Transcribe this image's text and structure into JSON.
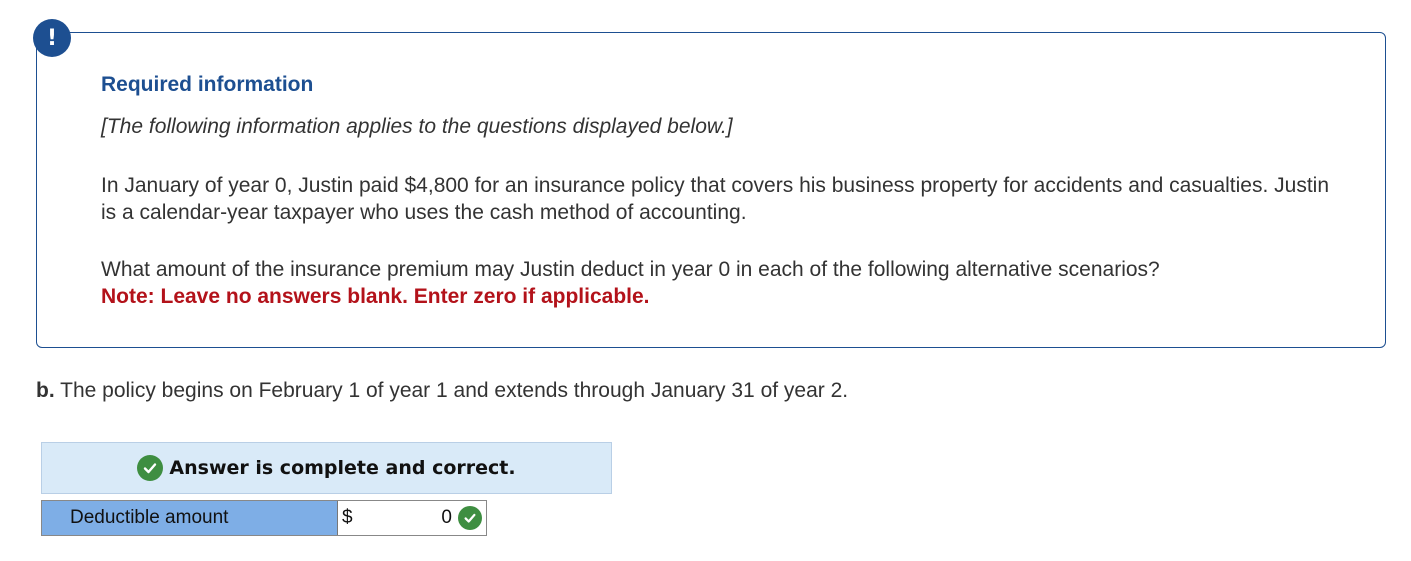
{
  "alert_icon_glyph": "!",
  "info": {
    "title": "Required information",
    "intro": "[The following information applies to the questions displayed below.]",
    "paragraph": "In January of year 0, Justin paid $4,800 for an insurance policy that covers his business property for accidents and casualties. Justin is a calendar-year taxpayer who uses the cash method of accounting.",
    "question": "What amount of the insurance premium may Justin deduct in year 0 in each of the following alternative scenarios?",
    "note": "Note: Leave no answers blank. Enter zero if applicable."
  },
  "question": {
    "part_label": "b.",
    "text": "The policy begins on February 1 of year 1 and extends through January 31 of year 2."
  },
  "answer": {
    "status": "Answer is complete and correct.",
    "rows": [
      {
        "label": "Deductible amount",
        "currency": "$",
        "value": "0"
      }
    ]
  },
  "colors": {
    "accent": "#1d4f91",
    "note_red": "#b3121a",
    "correct_green": "#3e8e41",
    "banner_bg": "#d9eaf8",
    "label_bg": "#7eaee6"
  }
}
